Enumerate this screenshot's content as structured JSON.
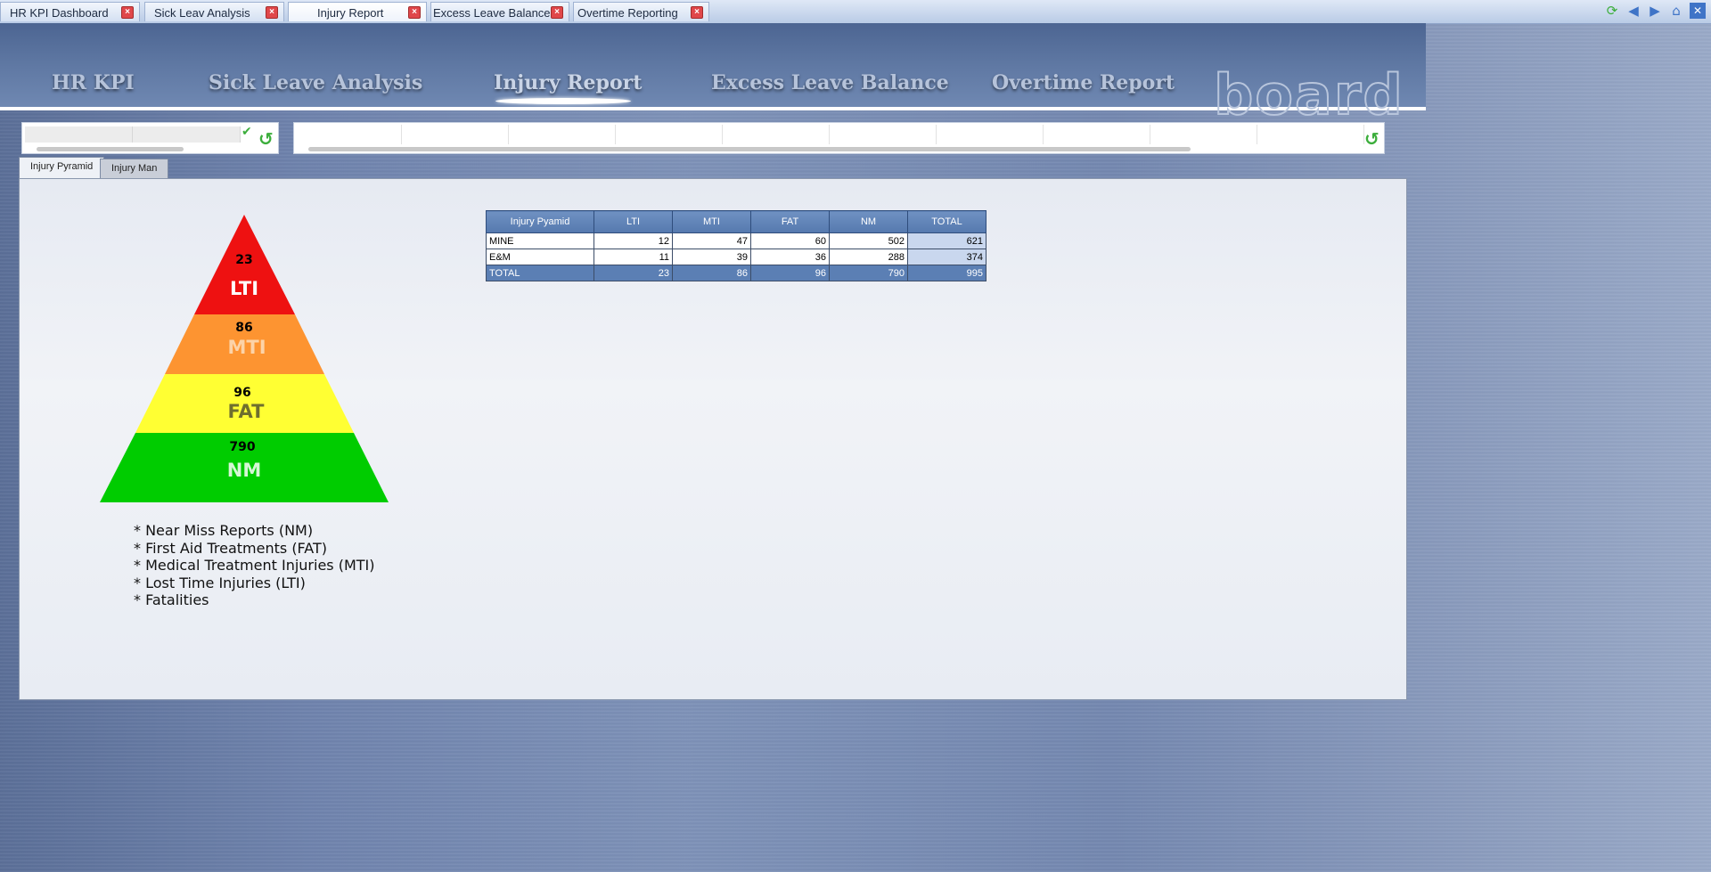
{
  "tabs": [
    {
      "label": "HR KPI Dashboard",
      "active": false
    },
    {
      "label": "Sick Leav Analysis",
      "active": false
    },
    {
      "label": "Injury Report",
      "active": true
    },
    {
      "label": "Excess Leave Balance",
      "active": false
    },
    {
      "label": "Overtime Reporting",
      "active": false
    }
  ],
  "nav": [
    {
      "label": "HR KPI"
    },
    {
      "label": "Sick Leave Analysis"
    },
    {
      "label": "Injury Report",
      "active": true
    },
    {
      "label": "Excess Leave Balance"
    },
    {
      "label": "Overtime Report"
    }
  ],
  "logo": "board",
  "subtabs": [
    {
      "label": "Injury Pyramid",
      "active": true
    },
    {
      "label": "Injury Man",
      "active": false
    }
  ],
  "pyramid": [
    {
      "value": "23",
      "code": "LTI",
      "color": "#ee1111"
    },
    {
      "value": "86",
      "code": "MTI",
      "color": "#fd9431"
    },
    {
      "value": "96",
      "code": "FAT",
      "color": "#ffff33"
    },
    {
      "value": "790",
      "code": "NM",
      "color": "#00cc00"
    }
  ],
  "legend": [
    "* Near Miss Reports (NM)",
    "* First Aid Treatments (FAT)",
    "* Medical Treatment Injuries (MTI)",
    "* Lost Time Injuries (LTI)",
    "* Fatalities"
  ],
  "table": {
    "headers": [
      "Injury Pyamid",
      "LTI",
      "MTI",
      "FAT",
      "NM",
      "TOTAL"
    ],
    "rows": [
      [
        "MINE",
        "12",
        "47",
        "60",
        "502",
        "621"
      ],
      [
        "E&M",
        "11",
        "39",
        "36",
        "288",
        "374"
      ],
      [
        "TOTAL",
        "23",
        "86",
        "96",
        "790",
        "995"
      ]
    ]
  },
  "colors": {
    "accent": "#5579ae",
    "refresh": "#3cae3c",
    "close": "#e0474a"
  }
}
